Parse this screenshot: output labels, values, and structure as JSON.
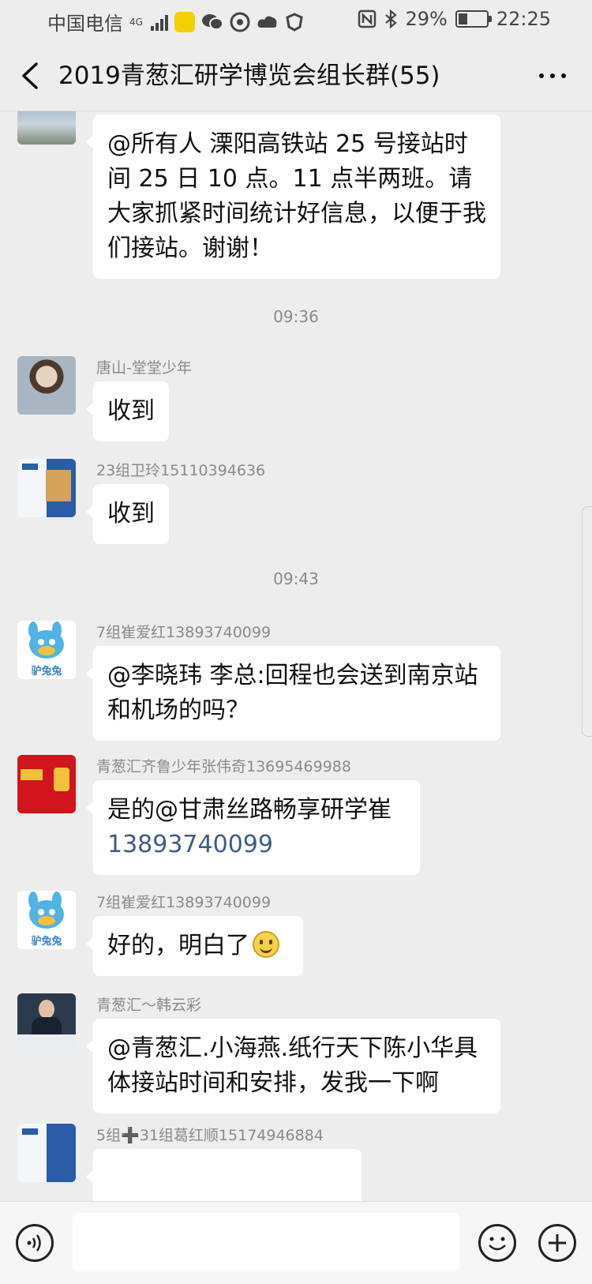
{
  "status_bar": {
    "carrier": "中国电信",
    "network": "4G",
    "app_badge": "漫阅小说",
    "battery_percent": "29%",
    "time": "22:25",
    "icons": [
      "signal-icon",
      "novel-app-icon",
      "wechat-icon",
      "app-icon",
      "cloud-icon",
      "shield-icon",
      "nfc-icon",
      "bluetooth-icon",
      "battery-icon"
    ]
  },
  "nav": {
    "title": "2019青葱汇研学博览会组长群(55)",
    "back_icon": "back-chevron-icon",
    "more_icon": "more-dots-icon"
  },
  "messages": [
    {
      "sender": "",
      "text": "@所有人  溧阳高铁站 25 号接站时间 25 日 10 点。11 点半两班。请大家抓紧时间统计好信息，以便于我们接站。谢谢！"
    },
    {
      "timestamp": "09:36"
    },
    {
      "sender": "唐山-堂堂少年",
      "text": "收到"
    },
    {
      "sender": "23组卫玲15110394636",
      "text": "收到"
    },
    {
      "timestamp": "09:43"
    },
    {
      "sender": "7组崔爱红13893740099",
      "text": "@李晓玮  李总:回程也会送到南京站和机场的吗？",
      "avatar_text": "驴兔兔"
    },
    {
      "sender": "青葱汇齐鲁少年张伟奇13695469988",
      "text": "是的@甘肃丝路畅享研学崔",
      "link": "13893740099"
    },
    {
      "sender": "7组崔爱红13893740099",
      "text": "好的，明白了",
      "avatar_text": "驴兔兔",
      "emoji": "smile-emoji"
    },
    {
      "sender": "青葱汇～韩云彩",
      "text": "@青葱汇.小海燕.纸行天下陈小华具体接站时间和安排，发我一下啊"
    },
    {
      "sender": "5组➕31组葛红顺15174946884",
      "text": ""
    }
  ],
  "input_bar": {
    "voice_icon": "voice-icon",
    "emoji_icon": "emoji-icon",
    "plus_icon": "plus-icon"
  },
  "colors": {
    "background": "#ededed",
    "bubble": "#ffffff",
    "link": "#3e5b8a",
    "meta_text": "#8a8a8a"
  }
}
